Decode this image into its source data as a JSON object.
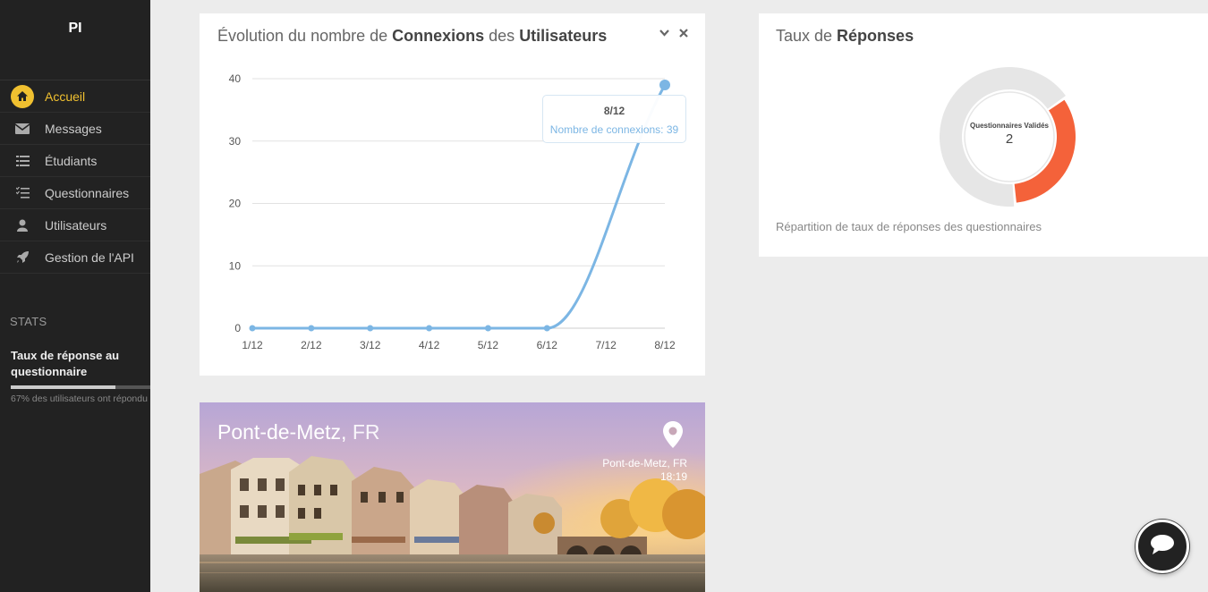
{
  "brand": "PI",
  "nav": [
    {
      "label": "Accueil",
      "icon": "home-icon",
      "active": true
    },
    {
      "label": "Messages",
      "icon": "envelope-icon"
    },
    {
      "label": "Étudiants",
      "icon": "list-icon"
    },
    {
      "label": "Questionnaires",
      "icon": "checklist-icon"
    },
    {
      "label": "Utilisateurs",
      "icon": "user-icon"
    },
    {
      "label": "Gestion de l'API",
      "icon": "rocket-icon"
    }
  ],
  "stats": {
    "title": "STATS",
    "label": "Taux de réponse au questionnaire",
    "progress": 0.67,
    "desc": "67% des utilisateurs ont répondu"
  },
  "connections_panel": {
    "title_pre": "Évolution du nombre de ",
    "title_b1": "Connexions",
    "title_mid": " des ",
    "title_b2": "Utilisateurs",
    "tooltip_title": "8/12",
    "tooltip_text": "Nombre de connexions: 39"
  },
  "chart_data": {
    "type": "line",
    "categories": [
      "1/12",
      "2/12",
      "3/12",
      "4/12",
      "5/12",
      "6/12",
      "7/12",
      "8/12"
    ],
    "series": [
      {
        "name": "Nombre de connexions",
        "values": [
          0,
          0,
          0,
          0,
          0,
          0,
          null,
          39
        ],
        "color": "#7cb6e4"
      }
    ],
    "yticks": [
      0,
      10,
      20,
      30,
      40
    ],
    "ylim": [
      0,
      40
    ],
    "grid": true
  },
  "responses_panel": {
    "title_pre": "Taux de ",
    "title_b": "Réponses",
    "center_label": "Questionnaires Validés",
    "center_value": "2",
    "desc": "Répartition de taux de réponses des questionnaires",
    "donut": [
      {
        "value": 1,
        "color": "#f4623a"
      },
      {
        "value": 2,
        "color": "#e6e6e6"
      }
    ]
  },
  "city_card": {
    "city": "Pont-de-Metz,",
    "country": " FR",
    "info_city": "Pont-de-Metz, FR",
    "time": "18:19"
  }
}
